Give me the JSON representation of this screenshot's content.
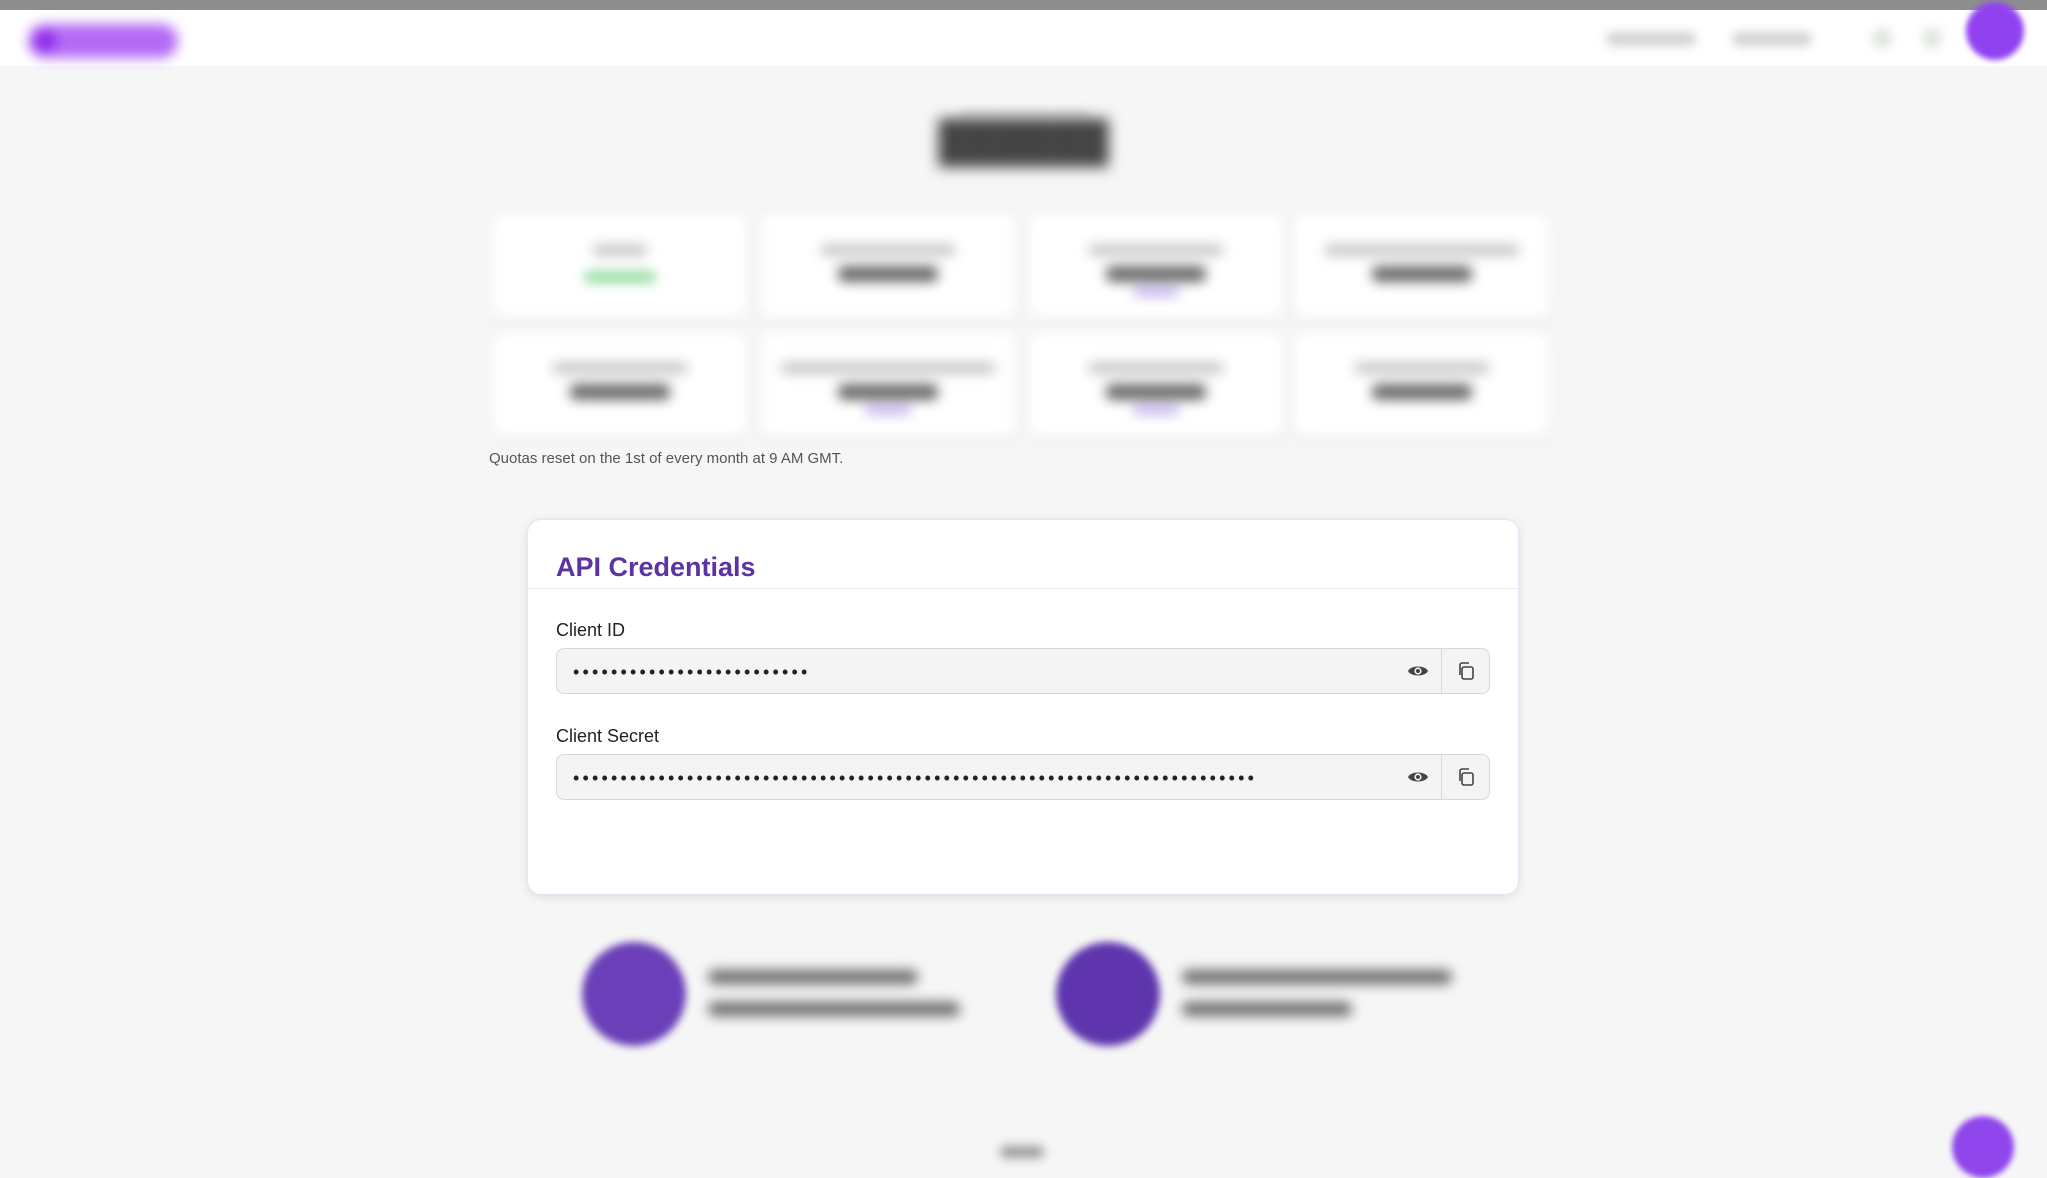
{
  "quotas": {
    "note": "Quotas reset on the 1st of every month at 9 AM GMT."
  },
  "credentials": {
    "title": "API Credentials",
    "client_id": {
      "label": "Client ID",
      "value": "•••••••••••••••••••••••••"
    },
    "client_secret": {
      "label": "Client Secret",
      "value": "••••••••••••••••••••••••••••••••••••••••••••••••••••••••••••••••••••••••"
    }
  },
  "colors": {
    "accent": "#5b33a3",
    "brand": "#9142f0",
    "status_green": "#7ed590"
  },
  "icons": {
    "reveal": "eye-icon",
    "copy": "copy-icon"
  }
}
